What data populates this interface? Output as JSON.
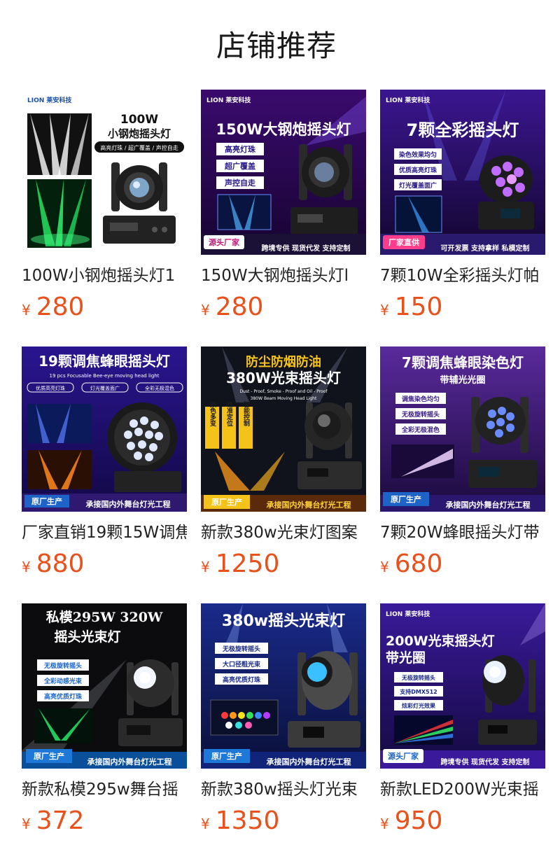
{
  "page": {
    "title": "店铺推荐"
  },
  "currency_symbol": "¥",
  "colors": {
    "price": "#e8501c",
    "title": "#1a1a1a"
  },
  "products": [
    {
      "name": "100W小钢炮摇头灯1",
      "price": "280",
      "image": {
        "brand": "LION 莱安科技",
        "headline_1": "100W",
        "headline_2": "小钢炮摇头灯",
        "tagline": "高亮灯珠 / 超广覆盖 / 声控自走"
      }
    },
    {
      "name": "150W大钢炮摇头灯l",
      "price": "280",
      "image": {
        "brand": "LION 莱安科技",
        "headline": "150W大钢炮摇头灯",
        "features": [
          "高亮灯珠",
          "超广覆盖",
          "声控自走"
        ],
        "badge": "源头厂家",
        "footer": "跨境专供  现货代发  支持定制"
      }
    },
    {
      "name": "7颗10W全彩摇头灯帕",
      "price": "150",
      "image": {
        "brand": "LION 莱安科技",
        "headline": "7颗全彩摇头灯",
        "features": [
          "染色效果均匀",
          "优质高亮灯珠",
          "灯光覆盖面广"
        ],
        "badge": "厂家直供",
        "footer": "可开发票  支持拿样  私模定制"
      }
    },
    {
      "name": "厂家直销19颗15W调焦",
      "price": "880",
      "image": {
        "headline": "19颗调焦蜂眼摇头灯",
        "subtitle": "19 pcs Focusable Bee-eye moving head light",
        "features": [
          "优质高亮灯珠",
          "灯光覆盖面广",
          "全彩无极混色"
        ],
        "badge": "原厂生产",
        "footer": "承接国内外舞台灯光工程"
      }
    },
    {
      "name": "新款380w光束灯图案",
      "price": "1250",
      "image": {
        "headline_1": "防尘防烟防油",
        "headline_2": "380W光束摇头灯",
        "subtitle": "Dust - Proof, Smoke - Proof and Oil - Proof",
        "subtitle_2": "380W Beam Moving Head Light",
        "features": [
          "颜色多变",
          "精准定位",
          "智能控制"
        ],
        "badge": "原厂生产",
        "footer": "承接国内外舞台灯光工程"
      }
    },
    {
      "name": "7颗20W蜂眼摇头灯带",
      "price": "680",
      "image": {
        "headline": "7颗调焦蜂眼染色灯",
        "headline_2": "带辅光光圈",
        "features": [
          "调焦染色均匀",
          "无极旋转摇头",
          "全彩无极混色"
        ],
        "badge": "原厂生产",
        "footer": "承接国内外舞台灯光工程"
      }
    },
    {
      "name": "新款私模295w舞台摇",
      "price": "372",
      "image": {
        "headline_1": "私模295W 320W",
        "headline_2": "摇头光束灯",
        "features": [
          "无极旋转摇头",
          "全彩动感光束",
          "高亮优质灯珠"
        ],
        "badge": "原厂生产",
        "footer": "承接国内外舞台灯光工程"
      }
    },
    {
      "name": "新款380w摇头灯光束",
      "price": "1350",
      "image": {
        "headline": "380w摇头光束灯",
        "features": [
          "无极旋转摇头",
          "大口径粗光束",
          "高亮优质灯珠"
        ],
        "badge": "原厂生产",
        "footer": "承接国内外舞台灯光工程"
      }
    },
    {
      "name": "新款LED200W光束摇",
      "price": "950",
      "image": {
        "brand": "LION 莱安科技",
        "headline": "200W光束摇头灯",
        "headline_2": "带光圈",
        "features": [
          "无极旋转摇头",
          "支持DMX512",
          "炫彩灯光效果"
        ],
        "badge": "源头厂家",
        "footer": "跨境专供  现货代发  支持定制"
      }
    }
  ]
}
